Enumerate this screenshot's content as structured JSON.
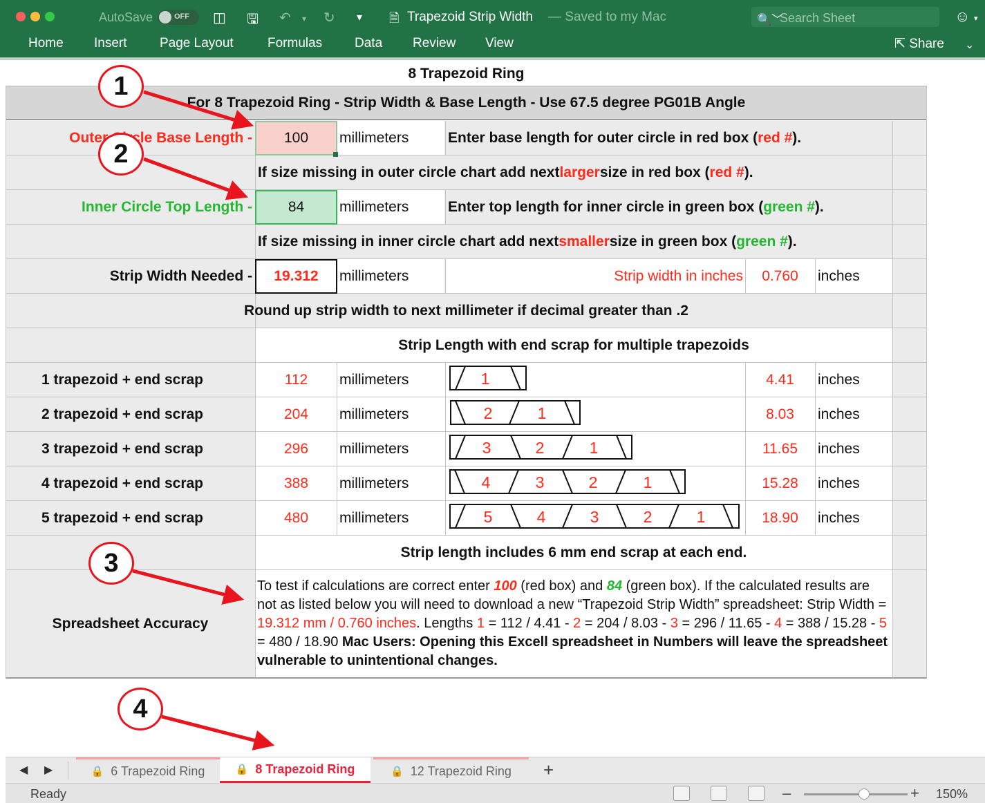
{
  "window": {
    "autosave_label": "AutoSave",
    "autosave_state": "OFF",
    "title": "Trapezoid Strip Width",
    "title_suffix": "— Saved to my Mac",
    "search_placeholder": "Search Sheet",
    "share_label": "Share"
  },
  "ribbon": {
    "tabs": [
      "Home",
      "Insert",
      "Page Layout",
      "Formulas",
      "Data",
      "Review",
      "View"
    ]
  },
  "sheet": {
    "title": "8 Trapezoid Ring",
    "banner": "For 8 Trapezoid Ring - Strip Width & Base Length - Use 67.5 degree PG01B Angle",
    "outer_label": "Outer Circle Base Length -",
    "outer_value": "100",
    "unit_mm": "millimeters",
    "unit_in": "inches",
    "outer_note": {
      "a": "Enter base length for outer circle in red box (",
      "b": "red #",
      "c": ")."
    },
    "outer_missing": {
      "a": "If size missing in outer circle chart add next ",
      "b": "larger",
      "c": " size in red box (",
      "d": "red #",
      "e": ")."
    },
    "inner_label": "Inner Circle Top Length -",
    "inner_value": "84",
    "inner_note": {
      "a": "Enter top length for inner circle in green box (",
      "b": "green #",
      "c": ")."
    },
    "inner_missing": {
      "a": "If size missing in inner circle chart add next ",
      "b": "smaller",
      "c": " size in green box (",
      "d": "green #",
      "e": ")."
    },
    "strip_label": "Strip Width Needed -",
    "strip_value": "19.312",
    "strip_in_label": "Strip width in inches",
    "strip_in_value": "0.760",
    "round_note": "Round up strip width to next millimeter if decimal greater than .2",
    "length_header": "Strip Length with end scrap for multiple trapezoids",
    "rows": [
      {
        "label": "1 trapezoid + end scrap",
        "mm": "112",
        "in": "4.41"
      },
      {
        "label": "2 trapezoid + end scrap",
        "mm": "204",
        "in": "8.03"
      },
      {
        "label": "3 trapezoid + end scrap",
        "mm": "296",
        "in": "11.65"
      },
      {
        "label": "4 trapezoid + end scrap",
        "mm": "388",
        "in": "15.28"
      },
      {
        "label": "5 trapezoid + end scrap",
        "mm": "480",
        "in": "18.90"
      }
    ],
    "scrap_note": "Strip length includes 6 mm end scrap at each end.",
    "accuracy_label": "Spreadsheet Accuracy",
    "accuracy": {
      "p1": "To test if calculations are correct enter ",
      "v100": "100",
      "p2": " (red box) and ",
      "v84": "84",
      "p3": " (green  box). If the calculated results are not as listed below you will need to download a new “Trapezoid Strip Width” spreadsheet:  Strip Width = ",
      "width": "19.312 mm / 0.760 inches",
      "p4": ".  Lengths ",
      "n1": "1",
      "l1": " = 112 / 4.41 - ",
      "n2": "2",
      "l2": " = 204 / 8.03 -",
      "n3": "3",
      "l3": " = 296 / 11.65 - ",
      "n4": "4",
      "l4": " = 388 / 15.28 -  ",
      "n5": "5",
      "l5": " = 480 / 18.90  ",
      "mac": "Mac Users: Opening this Excell spreadsheet in Numbers will leave the spreadsheet vulnerable to unintentional changes."
    }
  },
  "sheet_tabs": [
    "6 Trapezoid Ring",
    "8 Trapezoid Ring",
    "12 Trapezoid Ring"
  ],
  "add_sheet": "+",
  "status": {
    "ready": "Ready",
    "zoom": "150%",
    "zoom_fraction": 0.58
  },
  "callouts": [
    "1",
    "2",
    "3",
    "4"
  ],
  "colors": {
    "excel_green": "#217346",
    "red": "#ff2a1a",
    "green": "#22b830",
    "callout_red": "#e8141e"
  }
}
